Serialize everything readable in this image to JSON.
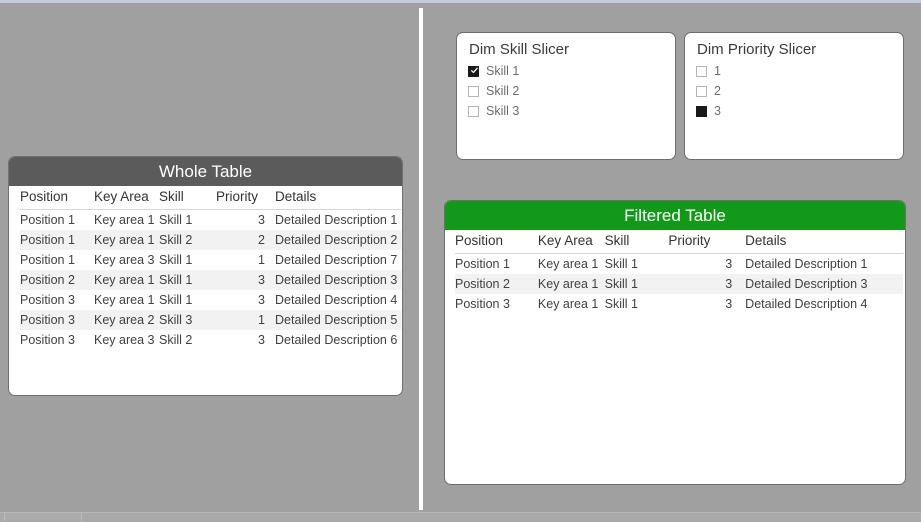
{
  "whole_table": {
    "title": "Whole Table",
    "columns": [
      "Position",
      "Key Area",
      "Skill",
      "Priority",
      "Details"
    ],
    "rows": [
      [
        "Position 1",
        "Key area 1",
        "Skill 1",
        "3",
        "Detailed Description 1"
      ],
      [
        "Position 1",
        "Key area 1",
        "Skill 2",
        "2",
        "Detailed Description 2"
      ],
      [
        "Position 1",
        "Key area 3",
        "Skill 1",
        "1",
        "Detailed Description 7"
      ],
      [
        "Position 2",
        "Key area 1",
        "Skill 1",
        "3",
        "Detailed Description 3"
      ],
      [
        "Position 3",
        "Key area 1",
        "Skill 1",
        "3",
        "Detailed Description 4"
      ],
      [
        "Position 3",
        "Key area 2",
        "Skill 3",
        "1",
        "Detailed Description 5"
      ],
      [
        "Position 3",
        "Key area 3",
        "Skill 2",
        "3",
        "Detailed Description 6"
      ]
    ]
  },
  "filtered_table": {
    "title": "Filtered Table",
    "columns": [
      "Position",
      "Key Area",
      "Skill",
      "Priority",
      "Details"
    ],
    "rows": [
      [
        "Position 1",
        "Key area 1",
        "Skill 1",
        "3",
        "Detailed Description 1"
      ],
      [
        "Position 2",
        "Key area 1",
        "Skill 1",
        "3",
        "Detailed Description 3"
      ],
      [
        "Position 3",
        "Key area 1",
        "Skill 1",
        "3",
        "Detailed Description 4"
      ]
    ]
  },
  "skill_slicer": {
    "title": "Dim Skill Slicer",
    "items": [
      {
        "label": "Skill 1",
        "checked": true
      },
      {
        "label": "Skill 2",
        "checked": false
      },
      {
        "label": "Skill 3",
        "checked": false
      }
    ]
  },
  "priority_slicer": {
    "title": "Dim Priority Slicer",
    "items": [
      {
        "label": "1",
        "checked": false
      },
      {
        "label": "2",
        "checked": false
      },
      {
        "label": "3",
        "checked": true
      }
    ]
  },
  "colors": {
    "page_background": "#a0a0a0",
    "whole_table_header": "#5b5b5b",
    "filtered_table_header": "#12991a",
    "card_background": "#ffffff",
    "divider": "#ffffff",
    "checkbox_selected": "#1a1a1a"
  }
}
